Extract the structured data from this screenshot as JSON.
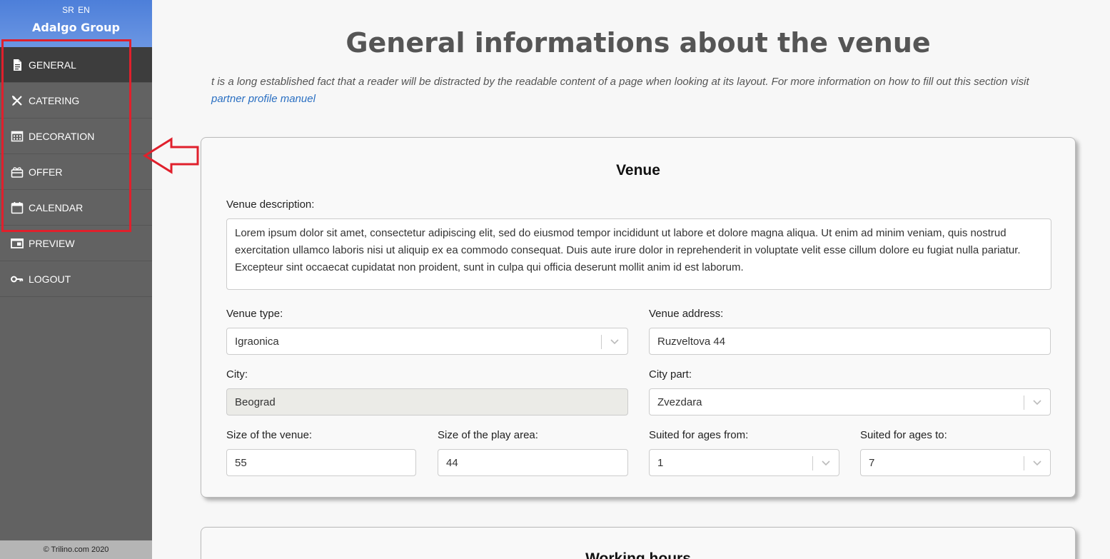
{
  "sidebar": {
    "languages": [
      "SR",
      "EN"
    ],
    "brand": "Adalgo Group",
    "items": [
      {
        "label": "GENERAL",
        "icon": "document-icon",
        "active": true
      },
      {
        "label": "CATERING",
        "icon": "utensils-icon"
      },
      {
        "label": "DECORATION",
        "icon": "decoration-icon"
      },
      {
        "label": "OFFER",
        "icon": "gift-icon"
      },
      {
        "label": "CALENDAR",
        "icon": "calendar-icon"
      },
      {
        "label": "PREVIEW",
        "icon": "preview-icon"
      },
      {
        "label": "LOGOUT",
        "icon": "key-icon"
      }
    ],
    "footer": "© Trilino.com 2020"
  },
  "main": {
    "title": "General informations about the venue",
    "intro_text": "t is a long established fact that a reader will be distracted by the readable content of a page when looking at its layout. For more information on how to fill out this section visit ",
    "intro_link": "partner profile manuel"
  },
  "venue_card": {
    "title": "Venue",
    "description_label": "Venue description:",
    "description_value": "Lorem ipsum dolor sit amet, consectetur adipiscing elit, sed do eiusmod tempor incididunt ut labore et dolore magna aliqua. Ut enim ad minim veniam, quis nostrud exercitation ullamco laboris nisi ut aliquip ex ea commodo consequat. Duis aute irure dolor in reprehenderit in voluptate velit esse cillum dolore eu fugiat nulla pariatur. Excepteur sint occaecat cupidatat non proident, sunt in culpa qui officia deserunt mollit anim id est laborum.",
    "type_label": "Venue type:",
    "type_value": "Igraonica",
    "address_label": "Venue address:",
    "address_value": "Ruzveltova 44",
    "city_label": "City:",
    "city_value": "Beograd",
    "city_part_label": "City part:",
    "city_part_value": "Zvezdara",
    "size_label": "Size of the venue:",
    "size_value": "55",
    "play_area_label": "Size of the play area:",
    "play_area_value": "44",
    "ages_from_label": "Suited for ages from:",
    "ages_from_value": "1",
    "ages_to_label": "Suited for ages to:",
    "ages_to_value": "7"
  },
  "hours_card": {
    "title": "Working hours"
  },
  "colors": {
    "sidebar_bg": "#626262",
    "sidebar_active": "#3d3d3d",
    "header_blue": "#5b8ae0",
    "annotation_red": "#e0202c",
    "link": "#2a6fc2"
  }
}
